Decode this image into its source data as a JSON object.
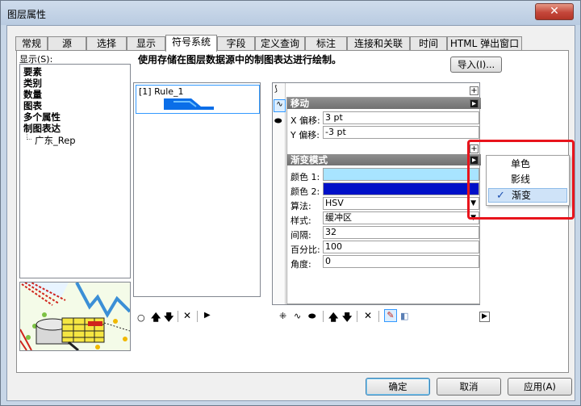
{
  "window": {
    "title": "图层属性",
    "close_label": "✕"
  },
  "tabs": [
    {
      "label": "常规"
    },
    {
      "label": "源"
    },
    {
      "label": "选择"
    },
    {
      "label": "显示"
    },
    {
      "label": "符号系统",
      "active": true
    },
    {
      "label": "字段"
    },
    {
      "label": "定义查询"
    },
    {
      "label": "标注"
    },
    {
      "label": "连接和关联"
    },
    {
      "label": "时间"
    },
    {
      "label": "HTML 弹出窗口"
    }
  ],
  "show_label": "显示(S):",
  "show_list": [
    "要素",
    "类别",
    "数量",
    "图表",
    "多个属性",
    "制图表达",
    "广东_Rep"
  ],
  "description": "使用存储在图层数据源中的制图表达进行绘制。",
  "import_button": "导入(I)...",
  "rules": [
    {
      "label": "[1] Rule_1"
    }
  ],
  "move_section": {
    "title": "移动",
    "fields": [
      {
        "label": "X 偏移:",
        "value": "3 pt"
      },
      {
        "label": "Y 偏移:",
        "value": "-3 pt"
      }
    ]
  },
  "gradient_section": {
    "title": "渐变模式",
    "color1_label": "颜色 1:",
    "color1": "#a8e4ff",
    "color2_label": "颜色 2:",
    "color2": "#0010c8",
    "algorithm_label": "算法:",
    "algorithm_value": "HSV",
    "style_label": "样式:",
    "style_value": "缓冲区",
    "interval_label": "间隔:",
    "interval_value": "32",
    "percent_label": "百分比:",
    "percent_value": "100",
    "angle_label": "角度:",
    "angle_value": "0"
  },
  "context_menu": {
    "items": [
      {
        "label": "单色"
      },
      {
        "label": "影线"
      },
      {
        "label": "渐变",
        "checked": true
      }
    ]
  },
  "footer": {
    "ok": "确定",
    "cancel": "取消",
    "apply": "应用(A)"
  }
}
